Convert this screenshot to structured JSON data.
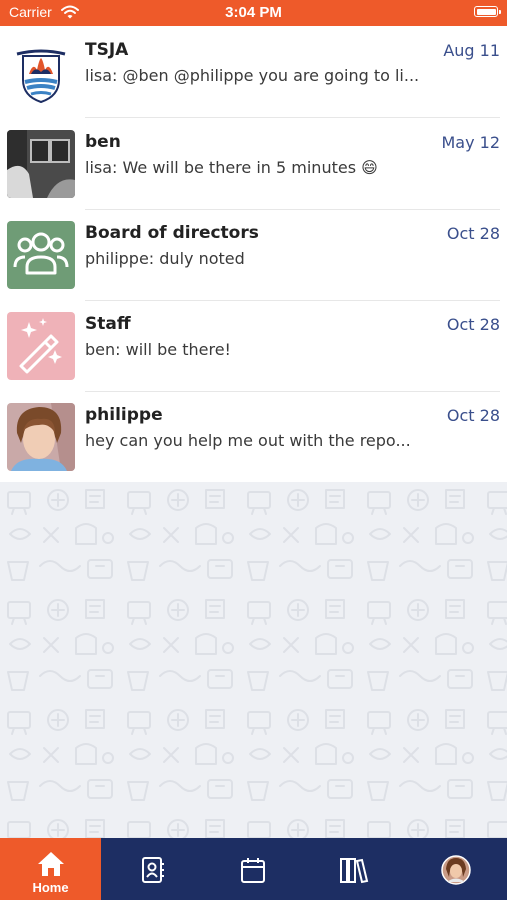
{
  "status_bar": {
    "carrier": "Carrier",
    "time": "3:04 PM"
  },
  "conversations": [
    {
      "name": "TSJA",
      "date": "Aug 11",
      "preview": "lisa: @ben @philippe you are going to li...",
      "avatar": "tsja-crest-logo"
    },
    {
      "name": "ben",
      "date": "May 12",
      "preview": "lisa: We will be there in 5 minutes 😄",
      "avatar": "ben-photo"
    },
    {
      "name": "Board of directors",
      "date": "Oct 28",
      "preview": "philippe: duly noted",
      "avatar": "group-people-icon",
      "avatar_color": "#6f9c76"
    },
    {
      "name": "Staff",
      "date": "Oct 28",
      "preview": "ben: will be there!",
      "avatar": "magic-wand-icon",
      "avatar_color": "#efb2b8"
    },
    {
      "name": "philippe",
      "date": "Oct 28",
      "preview": "hey can you help me out with the repo...",
      "avatar": "philippe-photo"
    }
  ],
  "tab_bar": {
    "tabs": [
      {
        "label": "Home",
        "icon": "home-icon",
        "active": true
      },
      {
        "label": "",
        "icon": "contacts-icon"
      },
      {
        "label": "",
        "icon": "calendar-icon"
      },
      {
        "label": "",
        "icon": "library-icon"
      },
      {
        "label": "",
        "icon": "profile-avatar"
      }
    ]
  },
  "colors": {
    "accent": "#ee5a2a",
    "tab_bar": "#1d2e63",
    "date_text": "#3a4f8c"
  }
}
